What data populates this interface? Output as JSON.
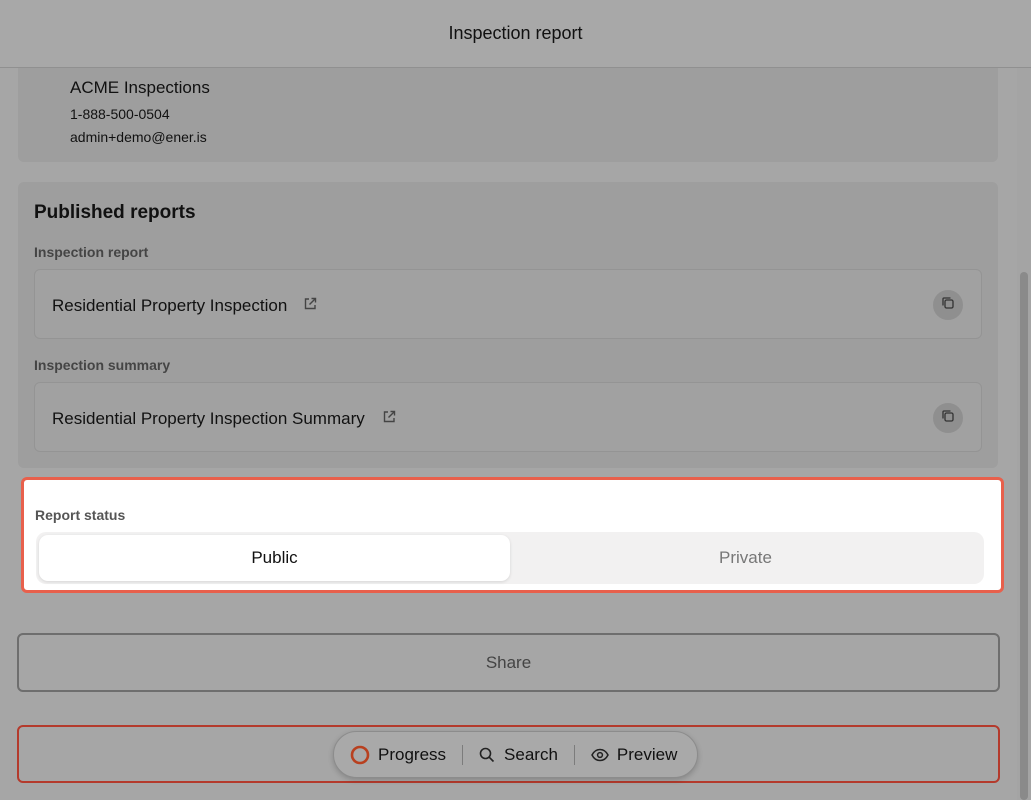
{
  "header": {
    "title": "Inspection report"
  },
  "company": {
    "name": "ACME Inspections",
    "phone": "1-888-500-0504",
    "email": "admin+demo@ener.is"
  },
  "published": {
    "title": "Published reports",
    "inspection_report": {
      "label": "Inspection report",
      "link": "Residential Property Inspection"
    },
    "inspection_summary": {
      "label": "Inspection summary",
      "link": "Residential Property Inspection Summary"
    }
  },
  "report_status": {
    "label": "Report status",
    "options": [
      "Public",
      "Private"
    ],
    "selected": "Public"
  },
  "share": {
    "label": "Share"
  },
  "bottom_nav": {
    "progress": "Progress",
    "search": "Search",
    "preview": "Preview"
  },
  "colors": {
    "highlight_border": "#e8604c",
    "progress_ring": "#b8401f"
  },
  "icons": [
    "external-link-icon",
    "copy-icon",
    "progress-ring-icon",
    "search-icon",
    "eye-icon"
  ]
}
